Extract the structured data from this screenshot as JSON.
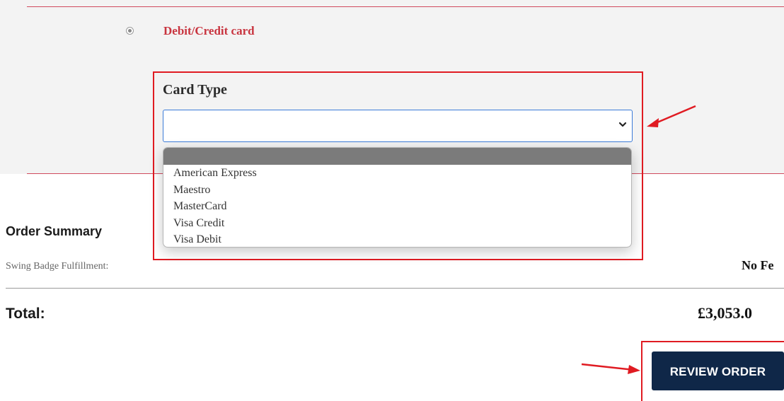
{
  "payment": {
    "method_label": "Debit/Credit card",
    "method_selected": true
  },
  "card_type": {
    "label": "Card Type",
    "selected_value": "",
    "options": [
      "",
      "American Express",
      "Maestro",
      "MasterCard",
      "Visa Credit",
      "Visa Debit"
    ]
  },
  "order_summary": {
    "title": "Order Summary",
    "fulfillment_label": "Swing Badge Fulfillment:",
    "fulfillment_value": "No Fe",
    "total_label": "Total:",
    "total_value": "£3,053.0"
  },
  "actions": {
    "review_order_label": "REVIEW ORDER"
  },
  "colors": {
    "accent_red": "#c8343f",
    "highlight_red": "#e01b22",
    "button_navy": "#0f2748",
    "focus_blue": "#3b7bd8"
  },
  "icons": [
    "chevron-down-icon",
    "radio-selected-icon",
    "annotation-arrow-icon"
  ]
}
